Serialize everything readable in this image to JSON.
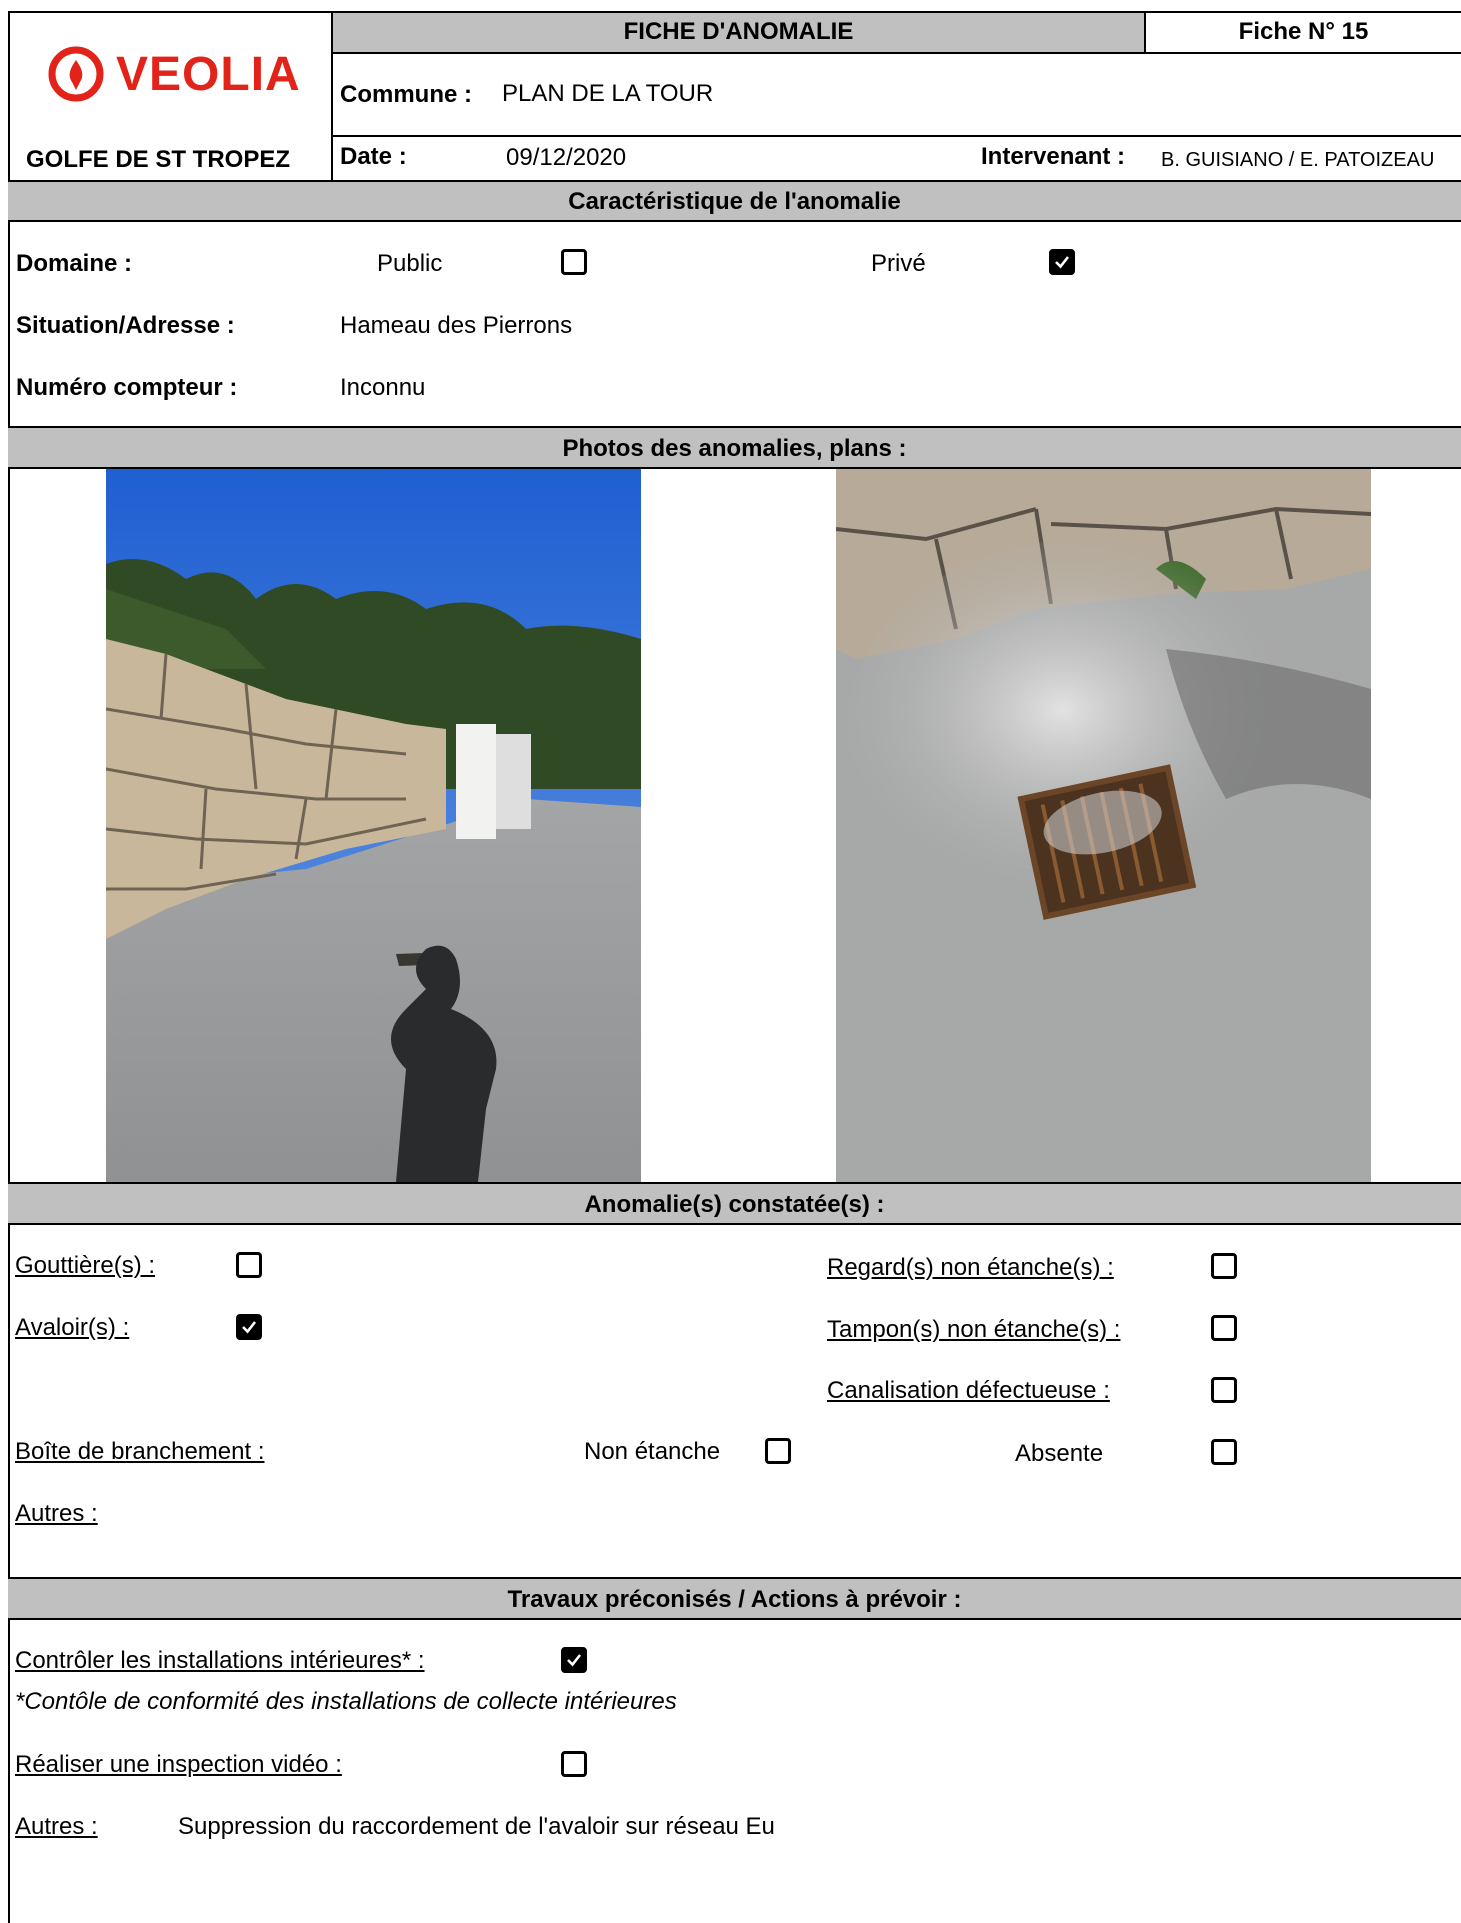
{
  "header": {
    "title": "FICHE D'ANOMALIE",
    "fiche_no": "Fiche N° 15",
    "logo_brand": "VEOLIA",
    "org": "GOLFE DE ST TROPEZ",
    "commune_label": "Commune :",
    "commune_value": "PLAN DE LA TOUR",
    "date_label": "Date :",
    "date_value": "09/12/2020",
    "intervenant_label": "Intervenant :",
    "intervenant_value": "B. GUISIANO / E. PATOIZEAU"
  },
  "caracteristique": {
    "title": "Caractéristique de l'anomalie",
    "domaine_label": "Domaine :",
    "public_label": "Public",
    "public_checked": false,
    "prive_label": "Privé",
    "prive_checked": true,
    "situation_label": "Situation/Adresse :",
    "situation_value": "Hameau des Pierrons",
    "compteur_label": "Numéro compteur :",
    "compteur_value": "Inconnu"
  },
  "photos": {
    "title": "Photos des anomalies, plans :"
  },
  "anomalies": {
    "title": "Anomalie(s) constatée(s) :",
    "gouttieres_label": "Gouttière(s) :",
    "gouttieres_checked": false,
    "avaloirs_label": "Avaloir(s) :",
    "avaloirs_checked": true,
    "regards_label": "Regard(s) non étanche(s) :",
    "regards_checked": false,
    "tampons_label": "Tampon(s) non étanche(s) :",
    "tampons_checked": false,
    "canalisation_label": "Canalisation défectueuse :",
    "canalisation_checked": false,
    "boite_label": "Boîte de branchement :",
    "non_etanche_label": "Non étanche",
    "non_etanche_checked": false,
    "absente_label": "Absente",
    "absente_checked": false,
    "autres_label": "Autres :"
  },
  "travaux": {
    "title": "Travaux préconisés / Actions à prévoir :",
    "controler_label": "Contrôler les installations intérieures* :",
    "controler_checked": true,
    "controle_note": "*Contôle de conformité des installations de collecte intérieures",
    "inspection_label": "Réaliser une inspection vidéo :",
    "inspection_checked": false,
    "autres_label": "Autres :",
    "autres_value": "Suppression du raccordement de l'avaloir sur réseau Eu"
  }
}
